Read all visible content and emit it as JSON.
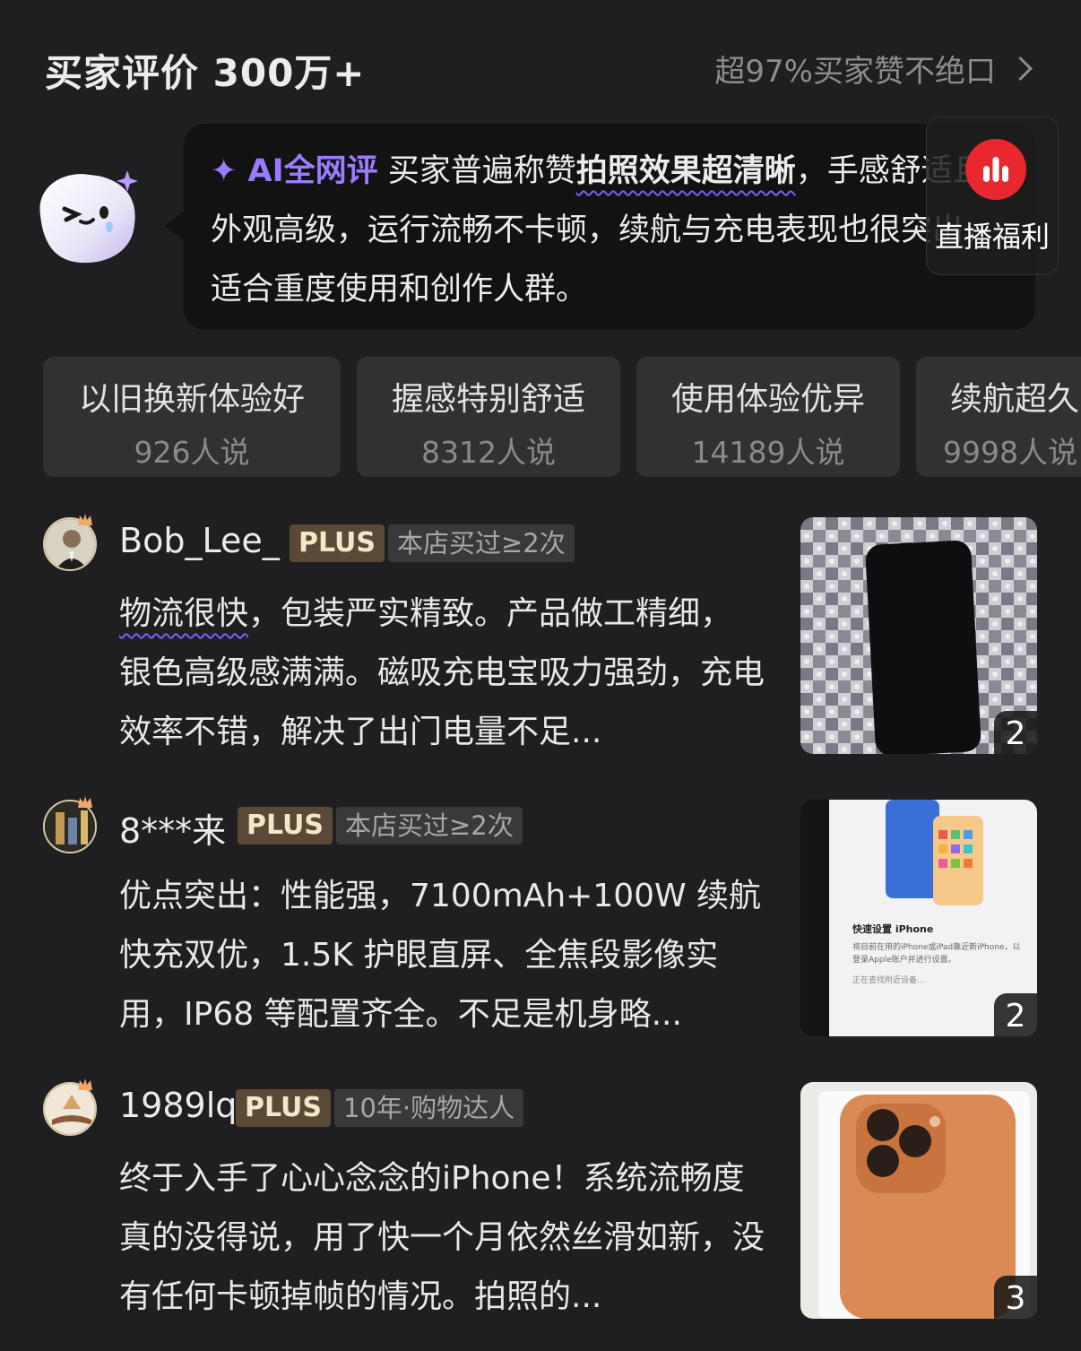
{
  "header": {
    "title": "买家评价 300万+",
    "right_text": "超97%买家赞不绝口"
  },
  "ai_summary": {
    "label": "✦ AI全网评",
    "part1": "买家普遍称赞",
    "highlight": "拍照效果超清晰",
    "part2": "，手感舒适且外观高级，运行流畅不卡顿，续航与充电表现也很突出，适合重度使用和创作人群。"
  },
  "live_widget": {
    "label": "直播福利"
  },
  "tags": [
    {
      "label": "以旧换新体验好",
      "count": "926人说"
    },
    {
      "label": "握感特别舒适",
      "count": "8312人说"
    },
    {
      "label": "使用体验优异",
      "count": "14189人说"
    },
    {
      "label": "续航超久",
      "count": "9998人说"
    }
  ],
  "reviews": [
    {
      "user": "Bob_Lee_",
      "plus": "PLUS",
      "store_badge": "本店买过≥2次",
      "text_highlight": "物流很快",
      "text": "，包装严实精致。产品做工精细，银色高级感满满。磁吸充电宝吸力强劲，充电效率不错，解决了出门电量不足...",
      "image_count": "2"
    },
    {
      "user": "8***来",
      "plus": "PLUS",
      "store_badge": "本店买过≥2次",
      "text": "优点突出：性能强，7100mAh+100W 续航快充双优，1.5K 护眼直屏、全焦段影像实用，IP68 等配置齐全。不足是机身略...",
      "image_count": "2",
      "image_caption_title": "快速设置 iPhone",
      "image_caption_body": "将目前在用的iPhone或iPad靠近新iPhone，以登录Apple账户并进行设置。",
      "image_caption_status": "正在查找附近设备..."
    },
    {
      "user": "1989lq",
      "plus": "PLUS",
      "store_badge": "10年·购物达人",
      "text": "终于入手了心心念念的iPhone！系统流畅度真的没得说，用了快一个月依然丝滑如新，没有任何卡顿掉帧的情况。拍照的...",
      "image_count": "3"
    }
  ],
  "colors": {
    "background": "#1f1f21",
    "ai_accent": "#9b7cff",
    "live_red": "#e9272f",
    "plus_bg": "#5a4936"
  }
}
